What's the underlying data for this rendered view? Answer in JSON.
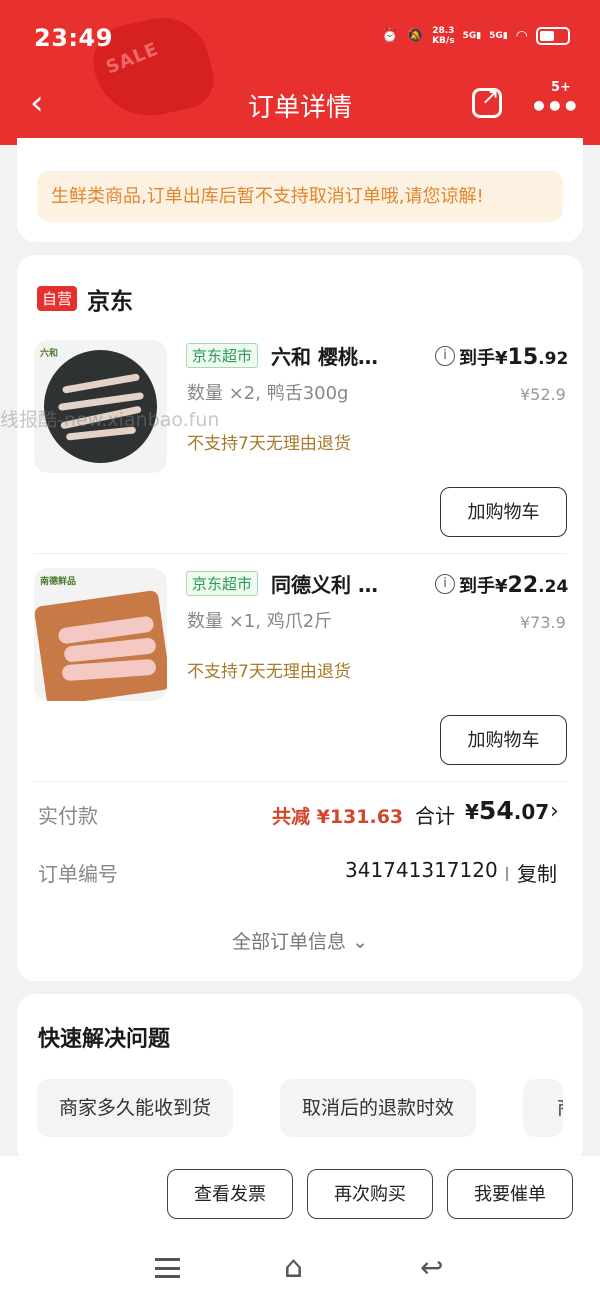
{
  "status_bar": {
    "time": "23:49",
    "net_speed": "28.3",
    "net_unit": "KB/s",
    "sig1": "5G",
    "sig2": "5G"
  },
  "header": {
    "title": "订单详情",
    "badge": "5+",
    "deco_text": "SALE"
  },
  "notice": "生鲜类商品,订单出库后暂不支持取消订单哦,请您谅解!",
  "store": {
    "badge": "自营",
    "name": "京东"
  },
  "products": [
    {
      "tag": "京东超市",
      "name": "六和 樱桃…",
      "spec": "数量 ×2, 鸭舌300g",
      "note": "不支持7天无理由退货",
      "price_prefix": "到手¥",
      "price_int": "15",
      "price_dec": ".92",
      "orig_price": "¥52.9",
      "cart_button": "加购物车",
      "logo": "六和"
    },
    {
      "tag": "京东超市",
      "name": "同德义利 …",
      "spec": "数量 ×1, 鸡爪2斤",
      "note": "不支持7天无理由退货",
      "price_prefix": "到手¥",
      "price_int": "22",
      "price_dec": ".24",
      "orig_price": "¥73.9",
      "cart_button": "加购物车",
      "logo": "南德鲜品"
    }
  ],
  "payment": {
    "label": "实付款",
    "saved": "共减 ¥131.63",
    "total_label": "合计",
    "total_prefix": "¥",
    "total_int": "54",
    "total_dec": ".07"
  },
  "order": {
    "label": "订单编号",
    "number": "341741317120",
    "copy": "复制"
  },
  "all_info": "全部订单信息",
  "quick": {
    "title": "快速解决问题",
    "chips": [
      "商家多久能收到货",
      "取消后的退款时效",
      "商"
    ]
  },
  "bottom_buttons": [
    "查看发票",
    "再次购买",
    "我要催单"
  ],
  "watermark": "线报酷-new.xianbao.fun"
}
